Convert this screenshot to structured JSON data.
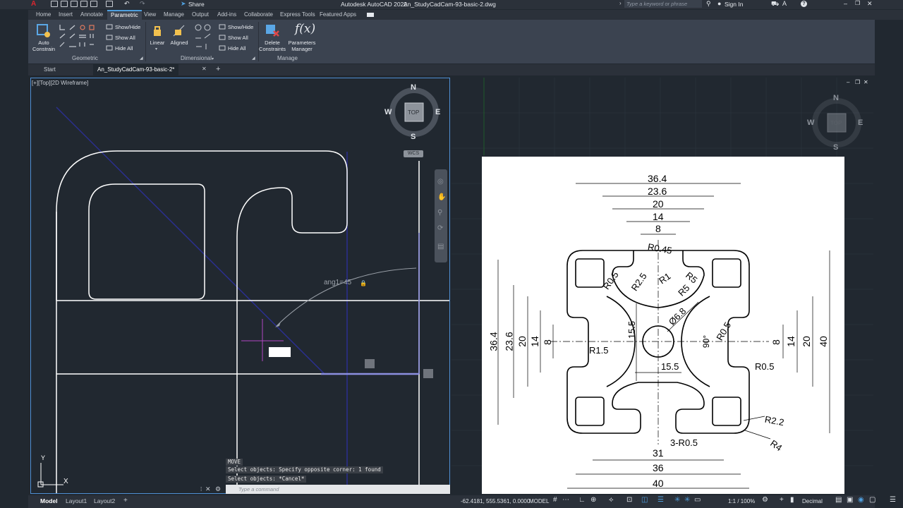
{
  "app": {
    "title": "Autodesk AutoCAD 2022",
    "filename": "An_StudyCadCam-93-basic-2.dwg",
    "share_label": "Share",
    "search_placeholder": "Type a keyword or phrase",
    "sign_in": "Sign In"
  },
  "ribbon_tabs": [
    "Home",
    "Insert",
    "Annotate",
    "Parametric",
    "View",
    "Manage",
    "Output",
    "Add-ins",
    "Collaborate",
    "Express Tools",
    "Featured Apps"
  ],
  "active_ribbon_tab": "Parametric",
  "ribbon": {
    "auto_constrain": [
      "Auto",
      "Constrain"
    ],
    "geo_show_hide": "Show/Hide",
    "geo_show_all": "Show All",
    "geo_hide_all": "Hide All",
    "linear": "Linear",
    "aligned": "Aligned",
    "dim_show_hide": "Show/Hide",
    "dim_show_all": "Show All",
    "dim_hide_all": "Hide All",
    "delete_constraints": [
      "Delete",
      "Constraints"
    ],
    "parameters_manager": [
      "Parameters",
      "Manager"
    ],
    "groups": {
      "geometric": "Geometric",
      "dimensional": "Dimensional",
      "manage": "Manage"
    }
  },
  "file_tabs": {
    "start": "Start",
    "active": "An_StudyCadCam-93-basic-2*"
  },
  "viewport_label": "[+][Top][2D Wireframe]",
  "viewcube": {
    "n": "N",
    "s": "S",
    "e": "E",
    "w": "W",
    "face": "TOP",
    "wcs": "WCS"
  },
  "drawing": {
    "angle_constraint": "ang1=45",
    "ucs_x": "X",
    "ucs_y": "Y"
  },
  "reference": {
    "top_dims": [
      "36.4",
      "23.6",
      "20",
      "14",
      "8"
    ],
    "left_dims": [
      "36.4",
      "23.6",
      "20",
      "14",
      "8"
    ],
    "right_dims": [
      "8",
      "14",
      "20",
      "40"
    ],
    "bottom_dims": [
      "31",
      "36",
      "40"
    ],
    "radii": [
      "R0.45",
      "R1",
      "R5",
      "R5",
      "R0.5",
      "R2.5",
      "R0.5",
      "R1.5",
      "R0.5",
      "R2.2",
      "R4",
      "3-R0.5"
    ],
    "diameter": "Ø6.8",
    "angle": "90°",
    "center_dim_v": "15.5",
    "center_dim_h": "15.5"
  },
  "command_line": {
    "history": [
      "MOVE",
      "Select objects: Specify opposite corner: 1 found",
      "Select objects: *Cancel*"
    ],
    "placeholder": "Type a command"
  },
  "status_bar": {
    "layout_tabs": [
      "Model",
      "Layout1",
      "Layout2"
    ],
    "coordinates": "-62.4181, 555.5361, 0.0000",
    "mode": "MODEL",
    "scale": "1:1 / 100%",
    "units": "Decimal"
  },
  "colors": {
    "background": "#212830",
    "ribbon": "#3b4350",
    "accent": "#4f8fd3",
    "geometry": "#ffffff",
    "construction": "#2a2f8f"
  }
}
